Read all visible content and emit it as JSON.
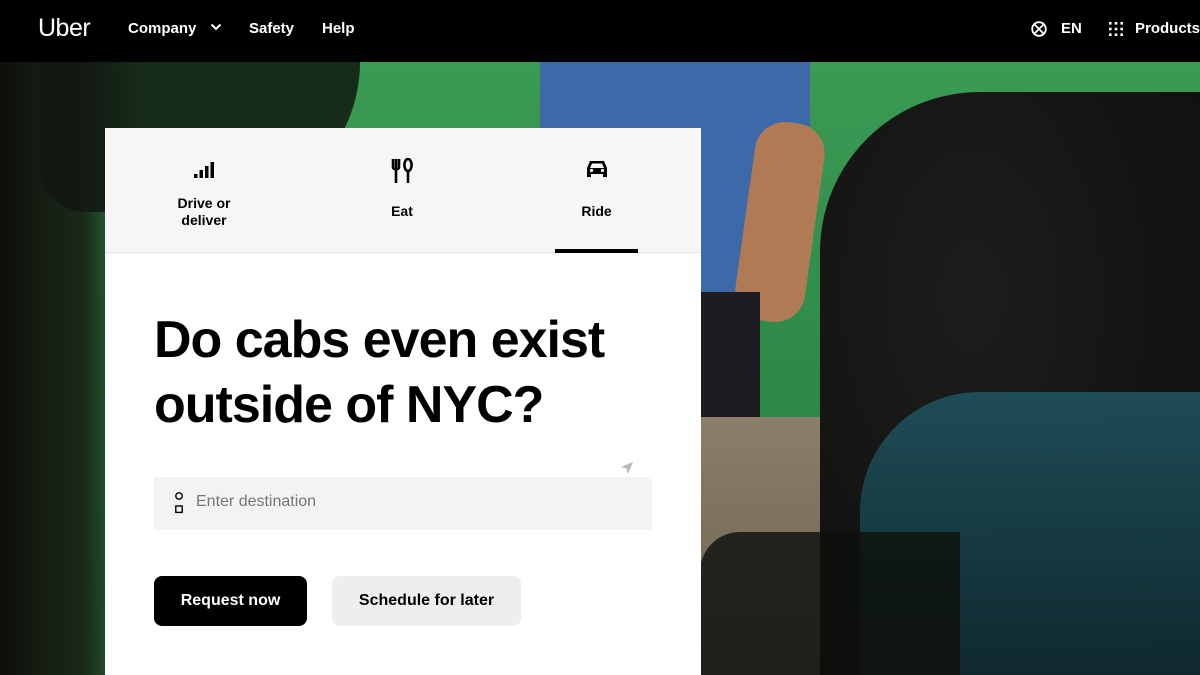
{
  "nav": {
    "logo": "Uber",
    "links": [
      {
        "label": "Company",
        "icon": "chevron-down-icon"
      },
      {
        "label": "Safety"
      },
      {
        "label": "Help"
      }
    ],
    "language": {
      "label": "EN",
      "icon": "globe-icon"
    },
    "products": {
      "label": "Products",
      "icon": "grid-dots-icon"
    }
  },
  "tabs": [
    {
      "label": "Drive or deliver",
      "icon": "signal-bars-icon",
      "active": false
    },
    {
      "label": "Eat",
      "icon": "fork-knife-icon",
      "active": false
    },
    {
      "label": "Ride",
      "icon": "car-icon",
      "active": true
    }
  ],
  "hero": {
    "headline_line1": "Do cabs even exist",
    "headline_line2": "outside of NYC?"
  },
  "destination": {
    "placeholder": "Enter destination",
    "value": "",
    "locate_icon": "location-arrow-icon"
  },
  "buttons": {
    "request_label": "Request now",
    "schedule_label": "Schedule for later"
  },
  "colors": {
    "nav_bg": "#000000",
    "primary_button": "#000000",
    "secondary_button": "#eeeeee",
    "hero_green": "#2e8847"
  }
}
